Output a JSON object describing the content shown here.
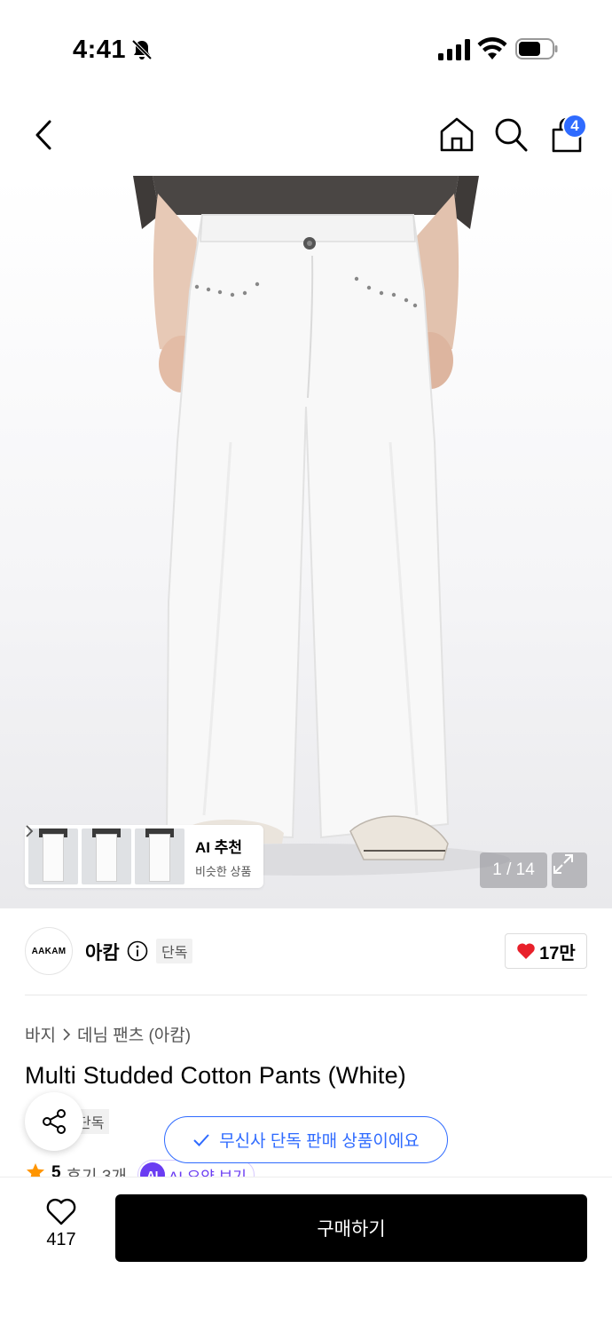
{
  "status_bar": {
    "time": "4:41"
  },
  "nav": {
    "cart_count": "4",
    "icons": [
      "back-icon",
      "home-icon",
      "search-icon",
      "cart-icon"
    ]
  },
  "gallery": {
    "counter": "1 / 14",
    "ai_recommend": {
      "title": "AI 추천",
      "subtitle": "비슷한 상품"
    }
  },
  "brand": {
    "logo_text": "AAKAM",
    "name": "아캄",
    "exclusive_tag": "단독",
    "likes": "17만"
  },
  "breadcrumb": {
    "category": "바지",
    "subcategory": "데님 팬츠 (아캄)"
  },
  "product": {
    "title": "Multi Studded Cotton Pants (White)",
    "exclusive_tag": "단독",
    "rating": "5",
    "reviews": "후기 3개",
    "ai_badge": "AI",
    "ai_summary": "AI 요약 보기"
  },
  "toast": {
    "text": "무신사 단독 판매 상품이에요"
  },
  "bottom": {
    "wish_count": "417",
    "buy_label": "구매하기"
  },
  "colors": {
    "accent_blue": "#2f6bff",
    "ai_purple": "#6a3cf2",
    "heart_red": "#e8202a",
    "star": "#ff9500"
  }
}
